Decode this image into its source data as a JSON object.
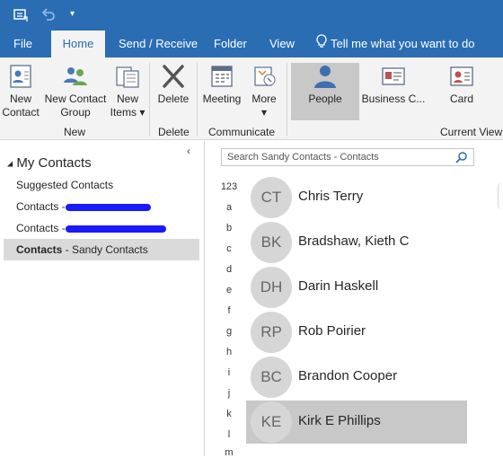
{
  "titlebar": {
    "icons": [
      "send-receive-all-icon",
      "undo-icon",
      "customize-qat-icon"
    ]
  },
  "tabs": [
    {
      "label": "File",
      "active": false
    },
    {
      "label": "Home",
      "active": true
    },
    {
      "label": "Send / Receive",
      "active": false
    },
    {
      "label": "Folder",
      "active": false
    },
    {
      "label": "View",
      "active": false
    }
  ],
  "tell_me": {
    "label": "Tell me what you want to do",
    "icon": "lightbulb-icon"
  },
  "ribbon": {
    "new_contact": [
      "New",
      "Contact"
    ],
    "new_contact_group": [
      "New Contact",
      "Group"
    ],
    "new_items": [
      "New",
      "Items ▾"
    ],
    "delete": "Delete",
    "meeting": "Meeting",
    "more": [
      "More",
      "▾"
    ],
    "people": "People",
    "business_card": "Business C...",
    "card": "Card",
    "groups": {
      "new": "New",
      "delete": "Delete",
      "communicate": "Communicate",
      "current_view": "Current View"
    }
  },
  "nav": {
    "collapse": "‹",
    "header": "My Contacts",
    "header_arrow": "◢",
    "items": [
      {
        "label": "Suggested Contacts",
        "suffix": ""
      },
      {
        "label": "Contacts - ",
        "suffix": ""
      },
      {
        "label": "Contacts - ",
        "suffix": ""
      },
      {
        "label": "Contacts",
        "suffix": " - Sandy Contacts",
        "selected": true
      }
    ]
  },
  "search": {
    "placeholder": "Search Sandy Contacts - Contacts"
  },
  "alphabet": [
    "123",
    "a",
    "b",
    "c",
    "d",
    "e",
    "f",
    "g",
    "h",
    "i",
    "j",
    "k",
    "l",
    "m"
  ],
  "contacts": [
    {
      "initials": "CT",
      "name": "Chris Terry",
      "selected": false
    },
    {
      "initials": "BK",
      "name": "Bradshaw, Kieth C",
      "selected": false
    },
    {
      "initials": "DH",
      "name": "Darin Haskell",
      "selected": false
    },
    {
      "initials": "RP",
      "name": "Rob Poirier",
      "selected": false
    },
    {
      "initials": "BC",
      "name": "Brandon Cooper",
      "selected": false
    },
    {
      "initials": "KE",
      "name": "Kirk E Phillips",
      "selected": true
    }
  ],
  "colors": {
    "accent": "#2b6db3",
    "ribbon_bg": "#f3f3f3",
    "avatar_bg": "#d6d6d6",
    "selected_bg": "#c8c8c8"
  }
}
